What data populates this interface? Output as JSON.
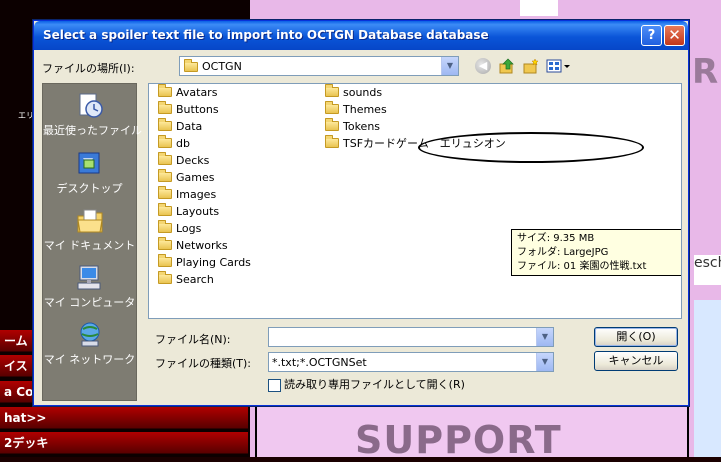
{
  "dialog": {
    "title": "Select a spoiler text file to import into OCTGN Database database",
    "help_glyph": "?",
    "close_glyph": "✕",
    "look_in_label": "ファイルの場所(I):",
    "look_in_value": "OCTGN",
    "places": [
      {
        "label": "最近使ったファイル",
        "icon": "recent-documents-icon"
      },
      {
        "label": "デスクトップ",
        "icon": "desktop-icon"
      },
      {
        "label": "マイ ドキュメント",
        "icon": "my-documents-icon"
      },
      {
        "label": "マイ コンピュータ",
        "icon": "my-computer-icon"
      },
      {
        "label": "マイ ネットワーク",
        "icon": "my-network-icon"
      }
    ],
    "files_col1": [
      "Avatars",
      "Buttons",
      "Data",
      "db",
      "Decks",
      "Games",
      "Images",
      "Layouts",
      "Logs",
      "Networks",
      "Playing Cards",
      "Search"
    ],
    "files_col2": [
      "sounds",
      "Themes",
      "Tokens",
      "TSFカードゲーム　エリュシオン"
    ],
    "tooltip": {
      "line1": "サイズ: 9.35 MB",
      "line2": "フォルダ: LargeJPG",
      "line3": "ファイル: 01 楽園の性戦.txt"
    },
    "file_name_label": "ファイル名(N):",
    "file_name_value": "",
    "file_type_label": "ファイルの種類(T):",
    "file_type_value": "*.txt;*.OCTGNSet",
    "readonly_label": "読み取り専用ファイルとして開く(R)",
    "open_label": "開く(O)",
    "cancel_label": "キャンセル"
  },
  "background": {
    "bars": [
      "ーム",
      "イス",
      "a Coin",
      "hat>>",
      "2デッキ"
    ],
    "support_text": "SUPPORT",
    "side_text": "esch",
    "side_big": "R",
    "mini_label": "エリ"
  },
  "colors": {
    "titlebar": "#0a55d8",
    "dialog_bg": "#ece9d8",
    "places_bg": "#7e7c72",
    "tooltip_bg": "#ffffe1"
  }
}
